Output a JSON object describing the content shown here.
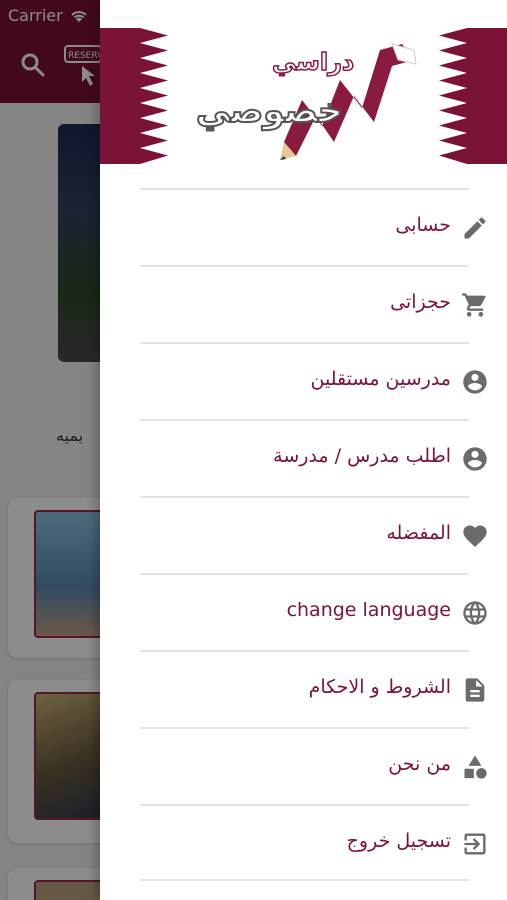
{
  "status_bar": {
    "carrier": "Carrier"
  },
  "background": {
    "reserve_icon_text": "RESERV",
    "caption_fragment": "يميه"
  },
  "logo": {
    "line1": "دراسي",
    "line2": "خصوصي"
  },
  "menu": {
    "items": [
      {
        "label": "حسابى",
        "icon": "pencil-icon"
      },
      {
        "label": "حجزاتى",
        "icon": "cart-icon"
      },
      {
        "label": "مدرسين مستقلين",
        "icon": "account-circle-icon"
      },
      {
        "label": "اطلب مدرس / مدرسة",
        "icon": "account-circle-icon"
      },
      {
        "label": "المفضله",
        "icon": "heart-icon"
      },
      {
        "label": "change language",
        "icon": "globe-icon"
      },
      {
        "label": "الشروط و الاحكام",
        "icon": "document-icon"
      },
      {
        "label": "من نحن",
        "icon": "shapes-icon"
      },
      {
        "label": "تسجيل خروج",
        "icon": "logout-icon"
      }
    ]
  },
  "colors": {
    "brand_maroon": "#7b1238",
    "icon_gray": "#6b6b6b",
    "divider": "#e3e3e3"
  }
}
